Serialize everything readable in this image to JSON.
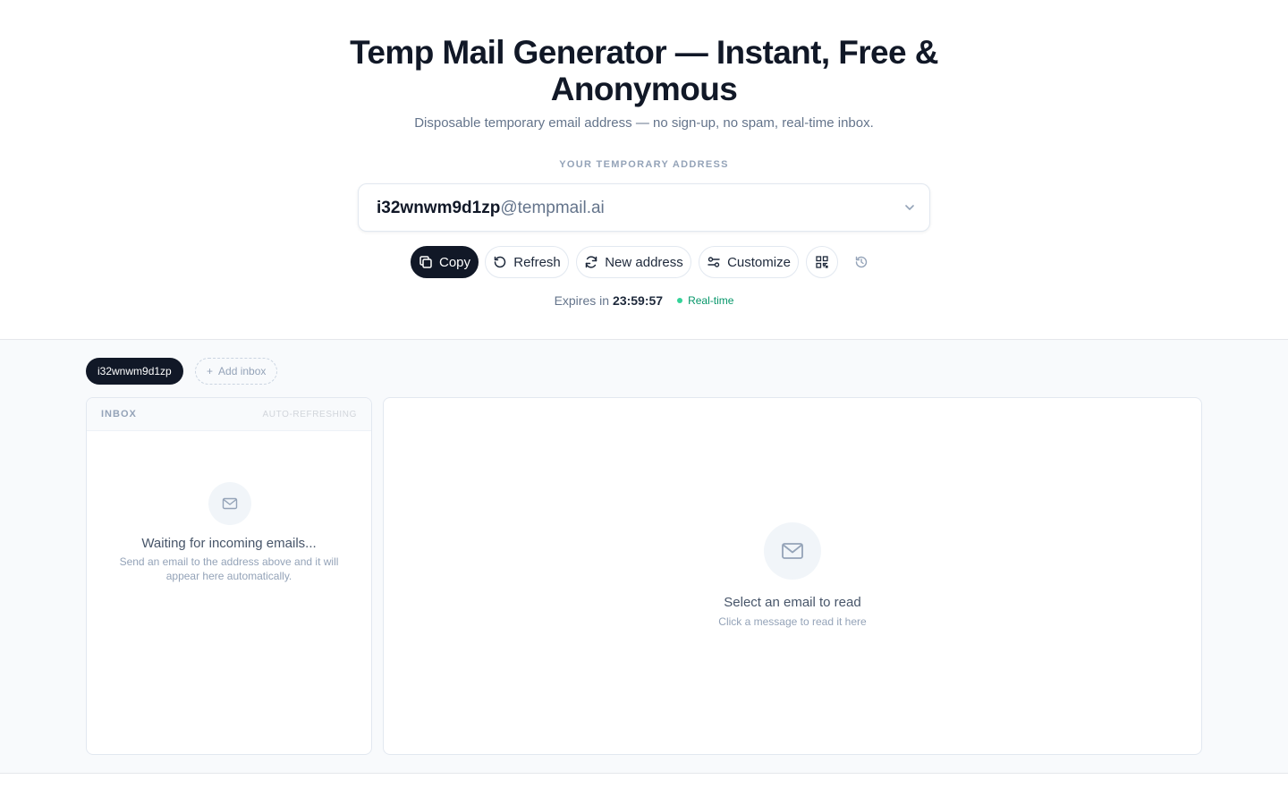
{
  "hero": {
    "title": "Temp Mail Generator — Instant, Free & Anonymous",
    "subtitle": "Disposable temporary email address — no sign-up, no spam, real-time inbox.",
    "address_label": "YOUR TEMPORARY ADDRESS"
  },
  "address": {
    "user": "i32wnwm9d1zp",
    "domain": "@tempmail.ai"
  },
  "actions": {
    "copy": "Copy",
    "refresh": "Refresh",
    "new_address": "New address",
    "customize": "Customize"
  },
  "status": {
    "expires_prefix": "Expires in",
    "countdown": "23:59:57",
    "realtime": "Real-time"
  },
  "tabs": {
    "active": "i32wnwm9d1zp",
    "add": "Add inbox"
  },
  "inbox": {
    "title": "INBOX",
    "status": "AUTO-REFRESHING",
    "empty_title": "Waiting for incoming emails...",
    "empty_desc": "Send an email to the address above and it will appear here automatically."
  },
  "reader": {
    "title": "Select an email to read",
    "desc": "Click a message to read it here"
  },
  "icons": {
    "copy": "copy-icon",
    "refresh": "refresh-icon",
    "new_address": "rotate-icon",
    "customize": "sliders-icon",
    "qr": "qr-code-icon",
    "history": "history-icon",
    "chevron": "chevron-down-icon",
    "plus": "plus-icon",
    "mail": "mail-icon"
  },
  "colors": {
    "primary": "#111827",
    "accent_green": "#059669",
    "muted": "#94a3b8"
  }
}
